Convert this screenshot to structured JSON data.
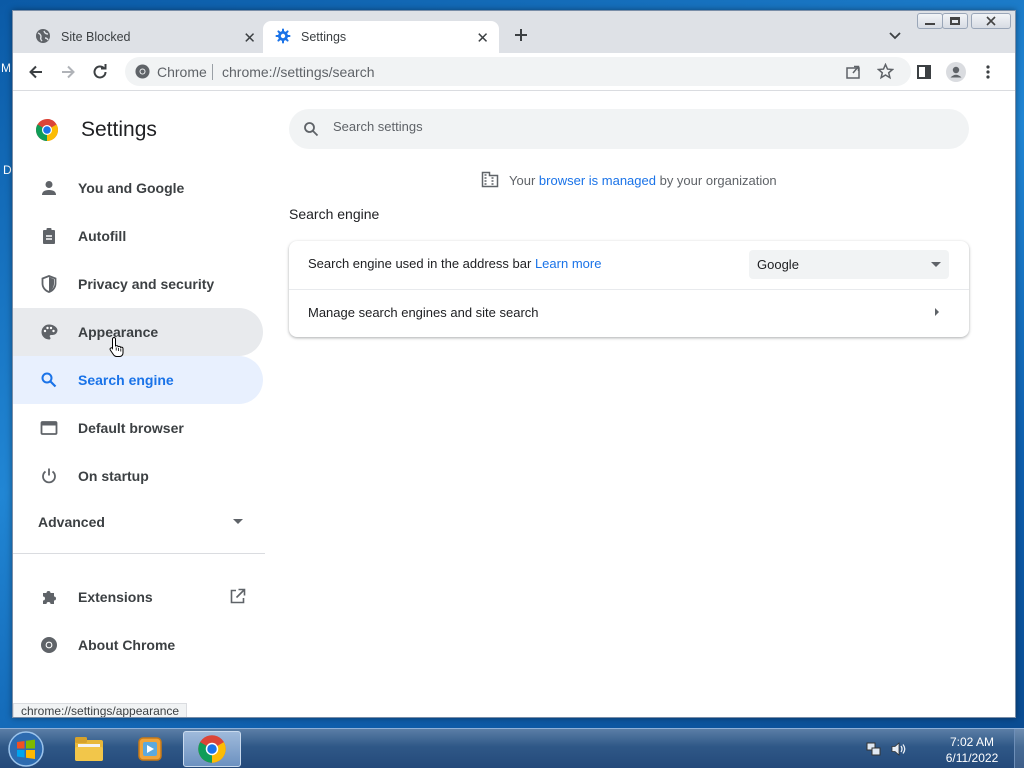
{
  "desktop": {
    "fragment_top": "M",
    "fragment_mid": "D"
  },
  "tabs": [
    {
      "title": "Site Blocked",
      "close": "✕"
    },
    {
      "title": "Settings",
      "close": "✕"
    }
  ],
  "toolbar": {
    "site_label": "Chrome",
    "url": "chrome://settings/search"
  },
  "sidebar": {
    "title": "Settings",
    "items": [
      {
        "label": "You and Google",
        "icon": "person-icon"
      },
      {
        "label": "Autofill",
        "icon": "clipboard-icon"
      },
      {
        "label": "Privacy and security",
        "icon": "shield-icon"
      },
      {
        "label": "Appearance",
        "icon": "palette-icon"
      },
      {
        "label": "Search engine",
        "icon": "search-icon"
      },
      {
        "label": "Default browser",
        "icon": "browser-icon"
      },
      {
        "label": "On startup",
        "icon": "power-icon"
      }
    ],
    "advanced": "Advanced",
    "extensions": "Extensions",
    "about": "About Chrome"
  },
  "search": {
    "placeholder": "Search settings"
  },
  "managed": {
    "prefix": "Your",
    "link": "browser is managed",
    "suffix": "by your organization"
  },
  "section": {
    "title": "Search engine",
    "row1_label": "Search engine used in the address bar",
    "row1_link": "Learn more",
    "row1_value": "Google",
    "row2_label": "Manage search engines and site search"
  },
  "status_url": "chrome://settings/appearance",
  "taskbar": {
    "time": "7:02 AM",
    "date": "6/11/2022"
  },
  "colors": {
    "accent": "#1a73e8",
    "active_bg": "#e8f0fe",
    "hover_bg": "#e8eaed"
  }
}
